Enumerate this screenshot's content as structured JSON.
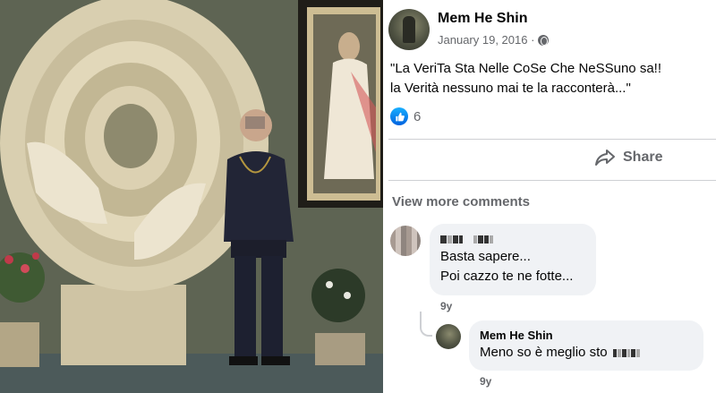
{
  "post": {
    "author": "Mem He Shin",
    "date": "January 19, 2016 ·",
    "privacy_icon": "globe-icon",
    "text_line1": "\"La VeriTa Sta Nelle CoSe Che NeSSuno sa!!",
    "text_line2": "la Verità nessuno mai te la racconterà...\"",
    "reaction_icon": "like-icon",
    "reaction_count": "6",
    "share_label": "Share"
  },
  "comments": {
    "view_more": "View more comments",
    "c1": {
      "line1": "Basta sapere...",
      "line2": "Poi cazzo te ne fotte...",
      "time": "9y"
    },
    "c2": {
      "author": "Mem He Shin",
      "text": "Meno so è meglio sto",
      "time": "9y"
    }
  },
  "colors": {
    "like_blue": "#0866ff",
    "meta_gray": "#65676b",
    "bubble_bg": "#f0f2f5"
  }
}
